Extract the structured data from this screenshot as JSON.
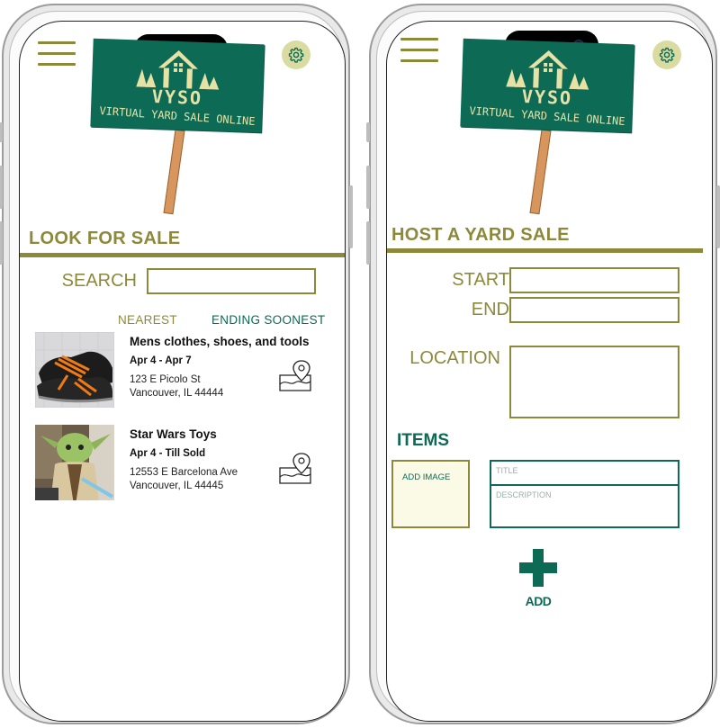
{
  "brand": {
    "name": "VYSO",
    "tagline": "VIRTUAL YARD SALE ONLINE"
  },
  "icons": {
    "menu": "hamburger-icon",
    "settings": "gear-icon",
    "map": "map-pin-icon",
    "add": "plus-icon"
  },
  "colors": {
    "olive": "#8c8a3a",
    "green": "#0d6a55",
    "sign_text": "#e6e2a6",
    "gear_bg": "#d9dba1"
  },
  "look": {
    "title": "LOOK FOR SALE",
    "search_label": "SEARCH",
    "search_value": "",
    "sort_nearest": "NEAREST",
    "sort_ending": "ENDING SOONEST",
    "listings": [
      {
        "title": "Mens clothes, shoes, and tools",
        "dates": "Apr 4 - Apr 7",
        "address_line1": "123 E Picolo St",
        "address_line2": "Vancouver, IL  44444"
      },
      {
        "title": "Star Wars Toys",
        "dates": "Apr 4 - Till Sold",
        "address_line1": "12553 E Barcelona Ave",
        "address_line2": "Vancouver, IL  44445"
      }
    ]
  },
  "host": {
    "title": "HOST A YARD SALE",
    "start_label": "START",
    "end_label": "END",
    "location_label": "LOCATION",
    "items_label": "ITEMS",
    "add_image": "ADD IMAGE",
    "item_title_placeholder": "TITLE",
    "item_description_placeholder": "DESCRIPTION",
    "add_label": "ADD"
  }
}
